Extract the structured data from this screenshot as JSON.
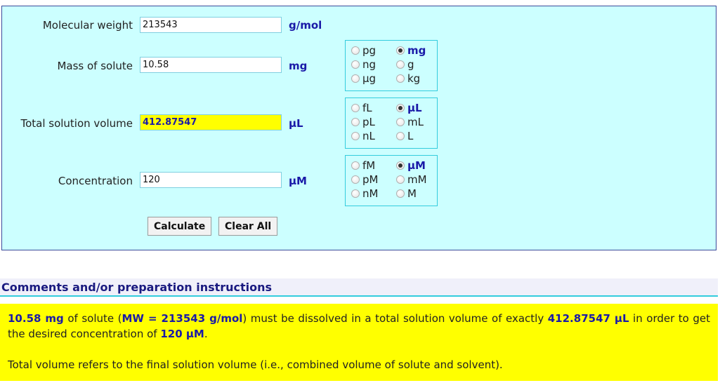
{
  "form": {
    "mw": {
      "label": "Molecular weight",
      "value": "213543",
      "unit": "g/mol"
    },
    "mass": {
      "label": "Mass of solute",
      "value": "10.58",
      "unit": "mg",
      "options": [
        {
          "label": "pg",
          "checked": false
        },
        {
          "label": "mg",
          "checked": true
        },
        {
          "label": "ng",
          "checked": false
        },
        {
          "label": "g",
          "checked": false
        },
        {
          "label": "µg",
          "checked": false
        },
        {
          "label": "kg",
          "checked": false
        }
      ]
    },
    "volume": {
      "label": "Total solution volume",
      "value": "412.87547",
      "unit": "µL",
      "options": [
        {
          "label": "fL",
          "checked": false
        },
        {
          "label": "µL",
          "checked": true
        },
        {
          "label": "pL",
          "checked": false
        },
        {
          "label": "mL",
          "checked": false
        },
        {
          "label": "nL",
          "checked": false
        },
        {
          "label": "L",
          "checked": false
        }
      ]
    },
    "concentration": {
      "label": "Concentration",
      "value": "120",
      "unit": "µM",
      "options": [
        {
          "label": "fM",
          "checked": false
        },
        {
          "label": "µM",
          "checked": true
        },
        {
          "label": "pM",
          "checked": false
        },
        {
          "label": "mM",
          "checked": false
        },
        {
          "label": "nM",
          "checked": false
        },
        {
          "label": "M",
          "checked": false
        }
      ]
    },
    "buttons": {
      "calculate": "Calculate",
      "clear": "Clear All"
    }
  },
  "comments": {
    "title": "Comments and/or preparation instructions",
    "mass": "10.58 mg",
    "t1": " of solute (",
    "mw": "MW = 213543 g/mol",
    "t2": ") must be dissolved in a total solution volume of exactly ",
    "volume": "412.87547 µL",
    "t3": " in order to get the desired concentration of ",
    "conc": "120 µM",
    "t4": ".",
    "note": "Total volume refers to the final solution volume (i.e., combined volume of solute and solvent)."
  }
}
